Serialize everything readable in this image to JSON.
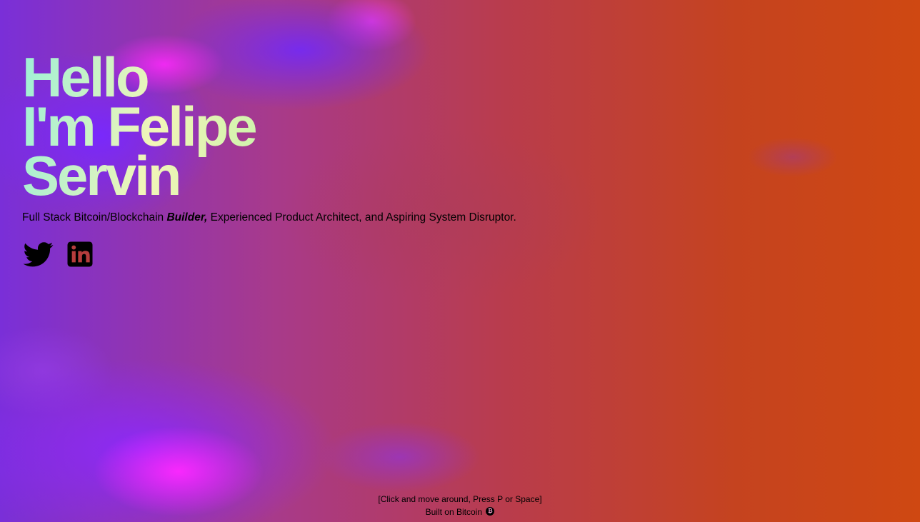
{
  "hero": {
    "line1": "Hello",
    "line2": "I'm Felipe",
    "line3": "Servin"
  },
  "tagline": {
    "before": "Full Stack Bitcoin/Blockchain ",
    "emphasis": "Builder,",
    "after": " Experienced Product Architect, and Aspiring System Disruptor."
  },
  "social": {
    "items": [
      {
        "name": "Twitter",
        "icon": "twitter-icon"
      },
      {
        "name": "LinkedIn",
        "icon": "linkedin-icon"
      }
    ]
  },
  "footer": {
    "hint": "[Click and move around, Press P or Space]",
    "built": "Built on Bitcoin",
    "btc_symbol": "₿"
  },
  "colors": {
    "headline_gradient": [
      "#9ef0d6",
      "#f2f5b8",
      "#5fe3a8"
    ],
    "background_left": "#7a2fd8",
    "background_right": "#cf4812",
    "text": "#000000"
  }
}
